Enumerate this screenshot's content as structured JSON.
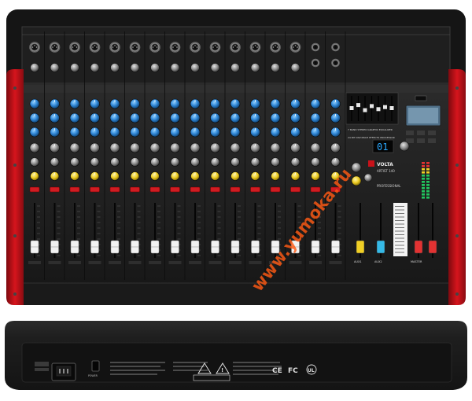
{
  "mixer": {
    "brand": "VOLTA",
    "model": "ARTIST 140",
    "series": "PROFESSIONAL",
    "effects_display_value": "01",
    "effects_section_label": "24 BIT DSP MULTI EFFECTS PROCESSOR",
    "eq_section_label": "7 BAND STEREO GRAPHIC EQUALIZER",
    "aux_labels": [
      "AUX1",
      "AUX2",
      "MASTER"
    ],
    "channel_count": 16
  },
  "rear_panel": {
    "marks": [
      "CE",
      "FC",
      "UL"
    ],
    "power_label": "POWER"
  },
  "watermark": "www.yumoka.ru",
  "colors": {
    "body": "#1c1c1c",
    "side_red": "#c8121a",
    "knob_blue": "#2f86d6",
    "fader_white": "#f2f2f2",
    "fader_yellow": "#f0cf25",
    "fader_cyan": "#35b9e6",
    "fader_red": "#e23232",
    "watermark": "#ff5a14"
  }
}
